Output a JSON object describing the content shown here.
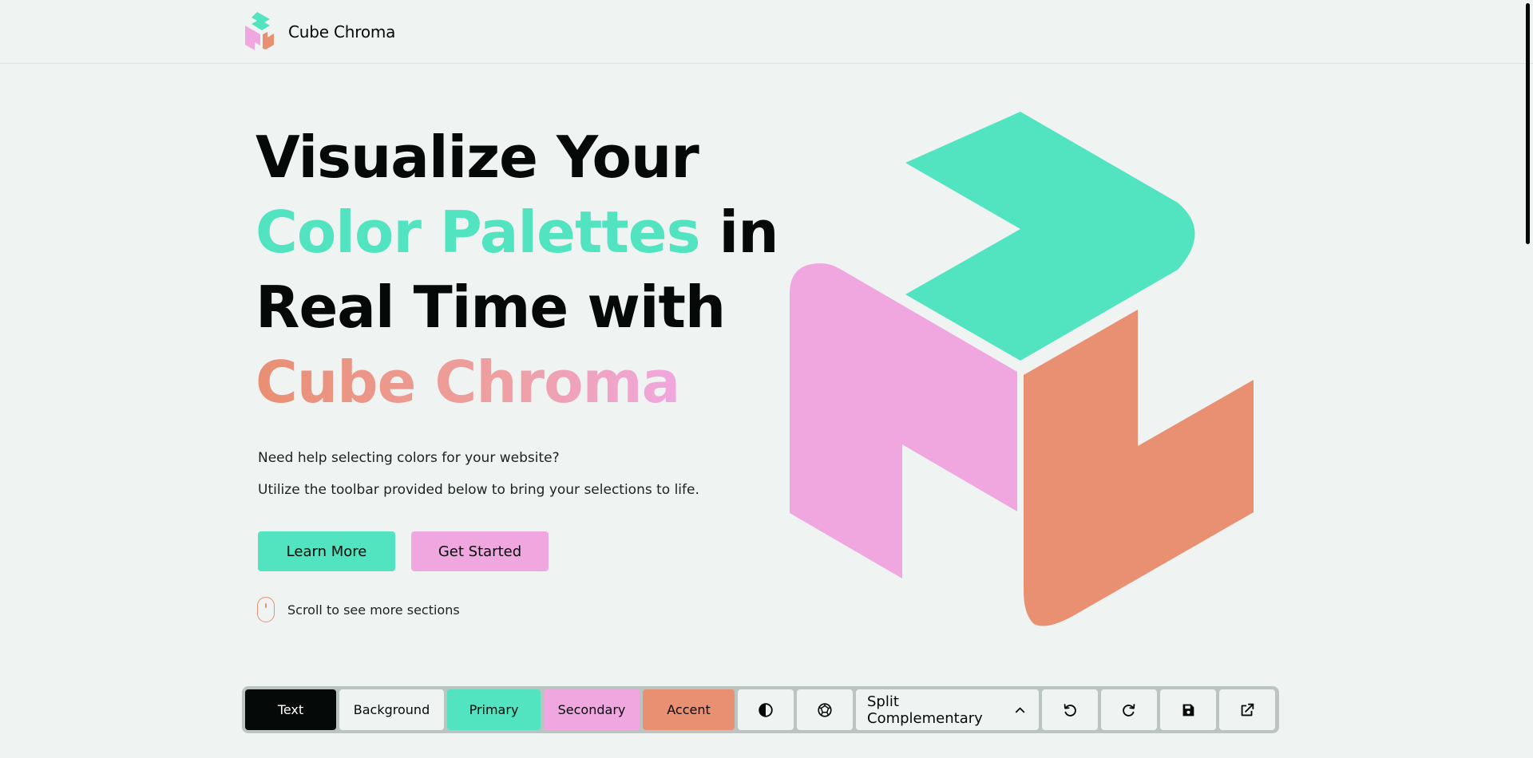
{
  "brand": {
    "name": "Cube Chroma"
  },
  "hero": {
    "title_line1": "Visualize Your",
    "title_line2_highlight": "Color Palettes",
    "title_line2_rest": " in",
    "title_line3": "Real Time with",
    "title_line4_highlight": "Cube Chroma",
    "subtitle1": "Need help selecting colors for your website?",
    "subtitle2": "Utilize the toolbar provided below to bring your selections to life.",
    "learn_more": "Learn More",
    "get_started": "Get Started",
    "scroll_hint": "Scroll to see more sections"
  },
  "toolbar": {
    "text_label": "Text",
    "background_label": "Background",
    "primary_label": "Primary",
    "secondary_label": "Secondary",
    "accent_label": "Accent",
    "scheme_value": "Split Complementary",
    "icons": [
      "contrast-icon",
      "random-palette-icon",
      "chevron-up-icon",
      "undo-icon",
      "redo-icon",
      "save-icon",
      "export-icon"
    ]
  },
  "colors": {
    "text": "#050a09",
    "background": "#eff3f2",
    "primary": "#52e3c0",
    "secondary": "#f0a7df",
    "accent": "#e98f72"
  }
}
